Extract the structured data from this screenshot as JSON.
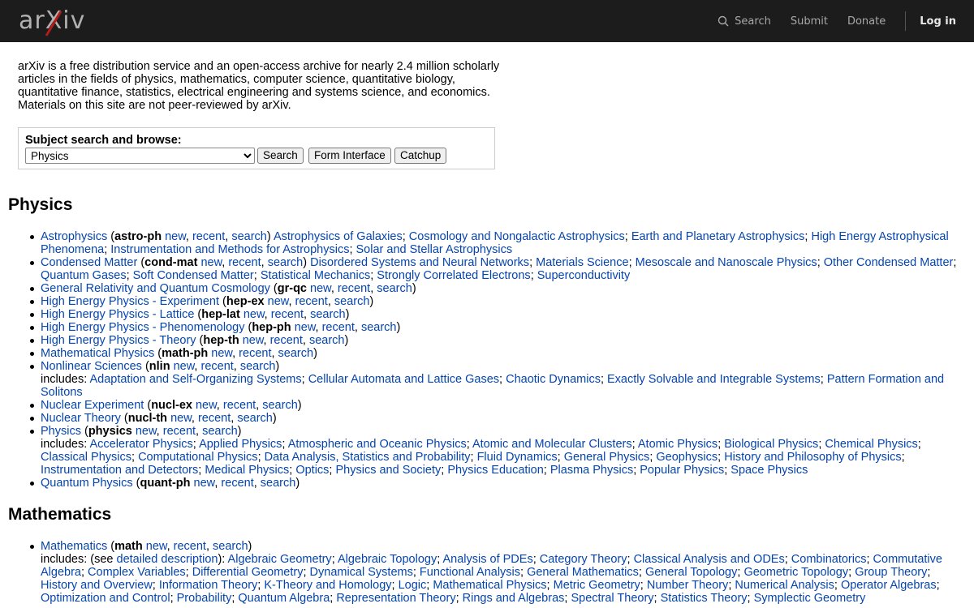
{
  "header": {
    "logo_text": "arXiv",
    "search_label": "Search",
    "submit_label": "Submit",
    "donate_label": "Donate",
    "login_label": "Log in"
  },
  "intro": "arXiv is a free distribution service and an open-access archive for nearly 2.4 million scholarly articles in the fields of physics, mathematics, computer science, quantitative biology, quantitative finance, statistics, electrical engineering and systems science, and economics. Materials on this site are not peer-reviewed by arXiv.",
  "subject_search": {
    "label": "Subject search and browse:",
    "selected": "Physics",
    "search_button": "Search",
    "form_button": "Form Interface",
    "catchup_button": "Catchup"
  },
  "sections": {
    "physics": {
      "title": "Physics",
      "items": [
        {
          "name": "Astrophysics",
          "code": "astro-ph",
          "subs": [
            "Astrophysics of Galaxies",
            "Cosmology and Nongalactic Astrophysics",
            "Earth and Planetary Astrophysics",
            "High Energy Astrophysical Phenomena",
            "Instrumentation and Methods for Astrophysics",
            "Solar and Stellar Astrophysics"
          ]
        },
        {
          "name": "Condensed Matter",
          "code": "cond-mat",
          "subs": [
            "Disordered Systems and Neural Networks",
            "Materials Science",
            "Mesoscale and Nanoscale Physics",
            "Other Condensed Matter",
            "Quantum Gases",
            "Soft Condensed Matter",
            "Statistical Mechanics",
            "Strongly Correlated Electrons",
            "Superconductivity"
          ]
        },
        {
          "name": "General Relativity and Quantum Cosmology",
          "code": "gr-qc"
        },
        {
          "name": "High Energy Physics - Experiment",
          "code": "hep-ex"
        },
        {
          "name": "High Energy Physics - Lattice",
          "code": "hep-lat"
        },
        {
          "name": "High Energy Physics - Phenomenology",
          "code": "hep-ph"
        },
        {
          "name": "High Energy Physics - Theory",
          "code": "hep-th"
        },
        {
          "name": "Mathematical Physics",
          "code": "math-ph"
        },
        {
          "name": "Nonlinear Sciences",
          "code": "nlin",
          "includes_label": "includes:",
          "includes": [
            "Adaptation and Self-Organizing Systems",
            "Cellular Automata and Lattice Gases",
            "Chaotic Dynamics",
            "Exactly Solvable and Integrable Systems",
            "Pattern Formation and Solitons"
          ]
        },
        {
          "name": "Nuclear Experiment",
          "code": "nucl-ex"
        },
        {
          "name": "Nuclear Theory",
          "code": "nucl-th"
        },
        {
          "name": "Physics",
          "code": "physics",
          "includes_label": "includes:",
          "includes": [
            "Accelerator Physics",
            "Applied Physics",
            "Atmospheric and Oceanic Physics",
            "Atomic and Molecular Clusters",
            "Atomic Physics",
            "Biological Physics",
            "Chemical Physics",
            "Classical Physics",
            "Computational Physics",
            "Data Analysis, Statistics and Probability",
            "Fluid Dynamics",
            "General Physics",
            "Geophysics",
            "History and Philosophy of Physics",
            "Instrumentation and Detectors",
            "Medical Physics",
            "Optics",
            "Physics and Society",
            "Physics Education",
            "Plasma Physics",
            "Popular Physics",
            "Space Physics"
          ]
        },
        {
          "name": "Quantum Physics",
          "code": "quant-ph"
        }
      ]
    },
    "mathematics": {
      "title": "Mathematics",
      "items": [
        {
          "name": "Mathematics",
          "code": "math",
          "includes_label": "includes: (see",
          "desc_link": "detailed description",
          "desc_after": "):",
          "includes": [
            "Algebraic Geometry",
            "Algebraic Topology",
            "Analysis of PDEs",
            "Category Theory",
            "Classical Analysis and ODEs",
            "Combinatorics",
            "Commutative Algebra",
            "Complex Variables",
            "Differential Geometry",
            "Dynamical Systems",
            "Functional Analysis",
            "General Mathematics",
            "General Topology",
            "Geometric Topology",
            "Group Theory",
            "History and Overview",
            "Information Theory",
            "K-Theory and Homology",
            "Logic",
            "Mathematical Physics",
            "Metric Geometry",
            "Number Theory",
            "Numerical Analysis",
            "Operator Algebras",
            "Optimization and Control",
            "Probability",
            "Quantum Algebra",
            "Representation Theory",
            "Rings and Algebras",
            "Spectral Theory",
            "Statistics Theory",
            "Symplectic Geometry"
          ]
        }
      ]
    }
  },
  "link_labels": {
    "new": "new",
    "recent": "recent",
    "search": "search"
  },
  "colors": {
    "header_bg": "#1c1c1c",
    "link": "#0645ad"
  }
}
